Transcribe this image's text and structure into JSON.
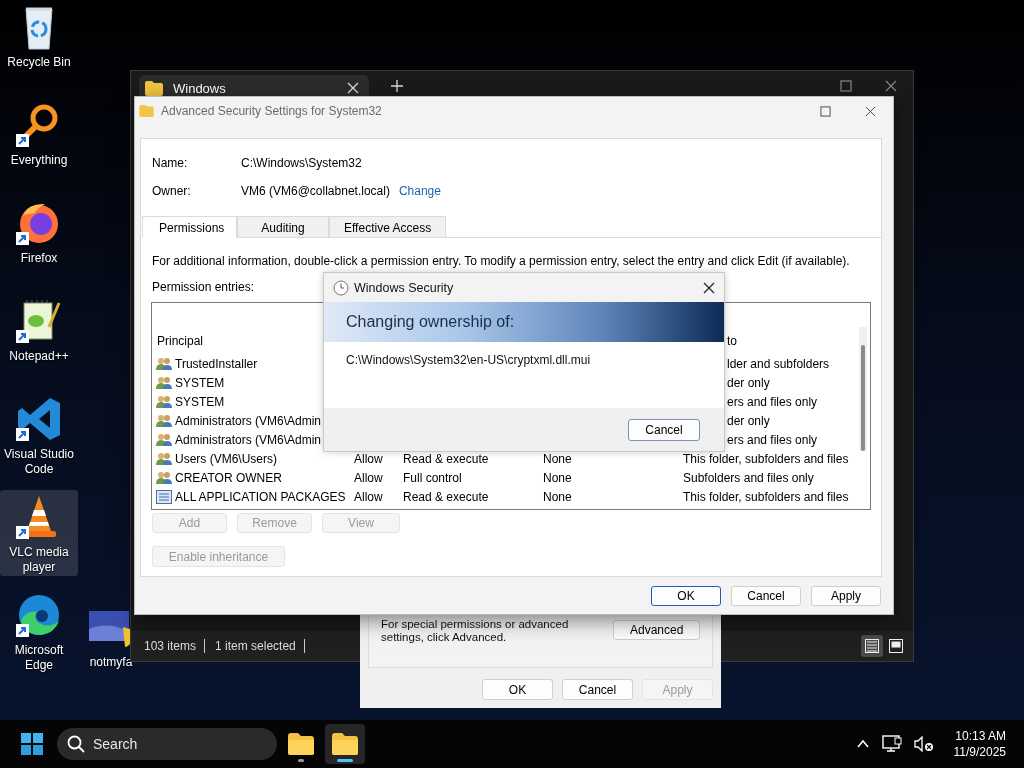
{
  "desktop_icons": [
    {
      "label": "Recycle Bin",
      "kind": "recycle",
      "selected": false
    },
    {
      "label": "Everything",
      "kind": "magnifier",
      "selected": false
    },
    {
      "label": "Firefox",
      "kind": "firefox",
      "selected": false
    },
    {
      "label": "Notepad++",
      "kind": "notepad",
      "selected": false
    },
    {
      "label": "Visual Studio Code",
      "kind": "vscode",
      "selected": false
    },
    {
      "label": "VLC media player",
      "kind": "cone",
      "selected": true
    },
    {
      "label": "Microsoft Edge",
      "kind": "edge",
      "selected": false
    }
  ],
  "partial_icon": {
    "label": "notmyfa",
    "kind": "image"
  },
  "explorer": {
    "tab_title": "Windows",
    "status_items": [
      "103 items",
      "1 item selected"
    ],
    "view_modes": [
      {
        "kind": "details",
        "selected": true
      },
      {
        "kind": "tiles",
        "selected": false
      }
    ]
  },
  "properties": {
    "note": "For special permissions or advanced settings, click Advanced.",
    "advanced_button": "Advanced",
    "buttons": [
      {
        "label": "OK",
        "disabled": false
      },
      {
        "label": "Cancel",
        "disabled": false
      },
      {
        "label": "Apply",
        "disabled": true
      }
    ]
  },
  "advanced": {
    "title": "Advanced Security Settings for System32",
    "name_label": "Name:",
    "name_value": "C:\\Windows\\System32",
    "owner_label": "Owner:",
    "owner_value": "VM6 (VM6@collabnet.local)",
    "change_link": "Change",
    "tabs": [
      {
        "label": "Permissions",
        "selected": true
      },
      {
        "label": "Auditing",
        "selected": false
      },
      {
        "label": "Effective Access",
        "selected": false
      }
    ],
    "info": "For additional information, double-click a permission entry. To modify a permission entry, select the entry and click Edit (if available).",
    "entries_label": "Permission entries:",
    "header": {
      "principal": "Principal",
      "applies_to": "to"
    },
    "rows": [
      {
        "kind": "group",
        "principal": "TrustedInstaller",
        "applies_to": "lder and subfolders"
      },
      {
        "kind": "group",
        "principal": "SYSTEM",
        "applies_to": "der only"
      },
      {
        "kind": "group",
        "principal": "SYSTEM",
        "applies_to": "ers and files only"
      },
      {
        "kind": "group",
        "principal": "Administrators (VM6\\Admin",
        "applies_to": "der only"
      },
      {
        "kind": "group",
        "principal": "Administrators (VM6\\Admin",
        "applies_to": "ers and files only"
      },
      {
        "kind": "group",
        "principal": "Users (VM6\\Users)",
        "type": "Allow",
        "access": "Read & execute",
        "inherited": "None",
        "applies_to": "This folder, subfolders and files"
      },
      {
        "kind": "group",
        "principal": "CREATOR OWNER",
        "type": "Allow",
        "access": "Full control",
        "inherited": "None",
        "applies_to": "Subfolders and files only"
      },
      {
        "kind": "package",
        "principal": "ALL APPLICATION PACKAGES",
        "type": "Allow",
        "access": "Read & execute",
        "inherited": "None",
        "applies_to": "This folder, subfolders and files"
      }
    ],
    "action_buttons": [
      {
        "label": "Add",
        "disabled": true
      },
      {
        "label": "Remove",
        "disabled": true
      },
      {
        "label": "View",
        "disabled": true
      }
    ],
    "inheritance_button": {
      "label": "Enable inheritance",
      "disabled": true
    },
    "buttons": [
      {
        "label": "OK",
        "focused": true
      },
      {
        "label": "Cancel",
        "focused": false
      },
      {
        "label": "Apply",
        "focused": false
      }
    ]
  },
  "security_dialog": {
    "title": "Windows Security",
    "heading": "Changing ownership of:",
    "path": "C:\\Windows\\System32\\en-US\\cryptxml.dll.mui",
    "button": "Cancel"
  },
  "taskbar": {
    "search_placeholder": "Search",
    "apps": [
      {
        "kind": "folder",
        "selected": false
      },
      {
        "kind": "folder",
        "selected": true
      }
    ],
    "time": "10:13 AM",
    "date": "11/9/2025"
  }
}
